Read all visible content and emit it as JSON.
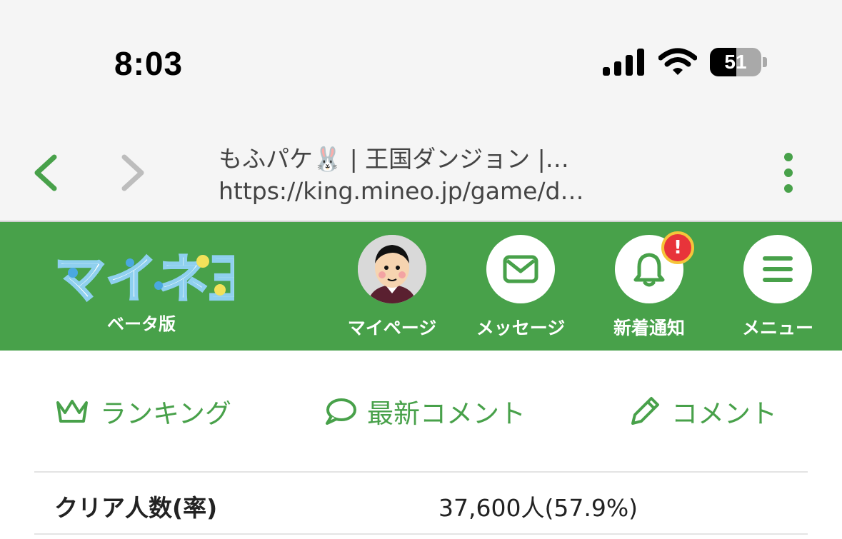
{
  "status_bar": {
    "time": "8:03",
    "battery_percent": "51",
    "icons": [
      "signal-icon",
      "wifi-icon",
      "battery-icon"
    ]
  },
  "browser": {
    "page_title": "もふパケ🐰 | 王国ダンジョン |…",
    "url": "https://king.mineo.jp/game/d…",
    "icons": [
      "back-icon",
      "forward-icon",
      "more-vertical-icon"
    ]
  },
  "header": {
    "logo_text": "マイネ王",
    "logo_sub": "ベータ版",
    "nav": [
      {
        "label": "マイページ",
        "icon": "avatar"
      },
      {
        "label": "メッセージ",
        "icon": "mail-icon"
      },
      {
        "label": "新着通知",
        "icon": "bell-icon",
        "badge": "!"
      },
      {
        "label": "メニュー",
        "icon": "hamburger-menu-icon"
      }
    ]
  },
  "tabs": [
    {
      "label": "ランキング",
      "icon": "crown-icon"
    },
    {
      "label": "最新コメント",
      "icon": "speech-bubble-icon"
    },
    {
      "label": "コメント",
      "icon": "pencil-icon"
    }
  ],
  "stats": {
    "clear_label": "クリア人数(率)",
    "clear_value": "37,600人(57.9%)"
  },
  "colors": {
    "brand_green": "#48a14a",
    "badge_red": "#e8343a",
    "badge_ring": "#f5c53a",
    "chrome_bg": "#f5f5f5"
  }
}
